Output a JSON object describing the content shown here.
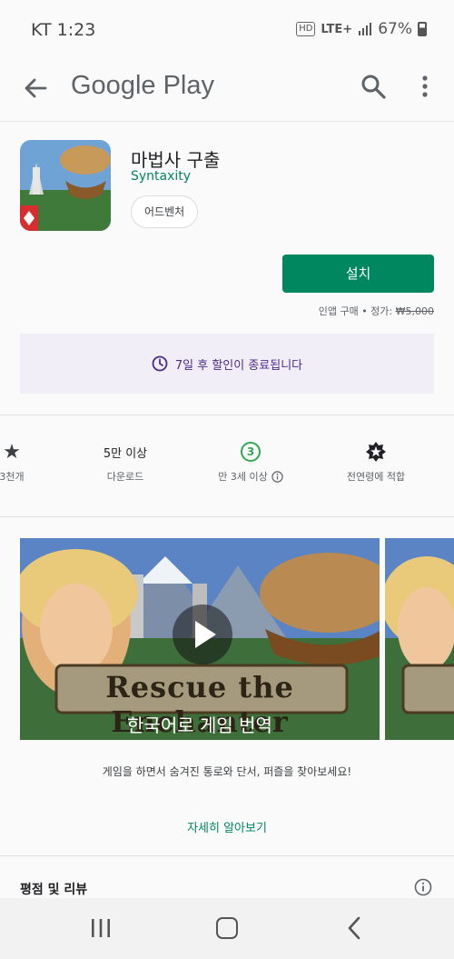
{
  "status_bar": {
    "carrier_time": "KT 1:23",
    "hd": "HD",
    "network": "LTE+",
    "battery": "67%"
  },
  "app_bar": {
    "title": "Google Play"
  },
  "app": {
    "name": "마법사 구출",
    "developer": "Syntaxity",
    "genre": "어드벤처",
    "install_label": "설치",
    "purchase_note": "인앱 구매 • 정가:",
    "original_price": "₩5,000",
    "promo_text": "7일 후 할인이 종료됩니다"
  },
  "stats": [
    {
      "top": "★",
      "bottom": "3천개"
    },
    {
      "top": "5만 이상",
      "bottom": "다운로드"
    },
    {
      "top": "3",
      "bottom": "만 3세 이상"
    },
    {
      "top": "star-badge-icon",
      "bottom": "전연령에 적합"
    }
  ],
  "media": {
    "video_title": "Rescue the Enchanter",
    "video_caption": "한국어로 게임 번역"
  },
  "description": "게임을 하면서 숨겨진 통로와 단서, 퍼즐을 찾아보세요!",
  "more_link": "자세히 알아보기",
  "reviews": {
    "title": "평점 및 리뷰"
  },
  "colors": {
    "accent": "#01875f",
    "promo_bg": "#f1eef8",
    "promo_text": "#4b2c8c",
    "rating_green": "#34a853"
  }
}
